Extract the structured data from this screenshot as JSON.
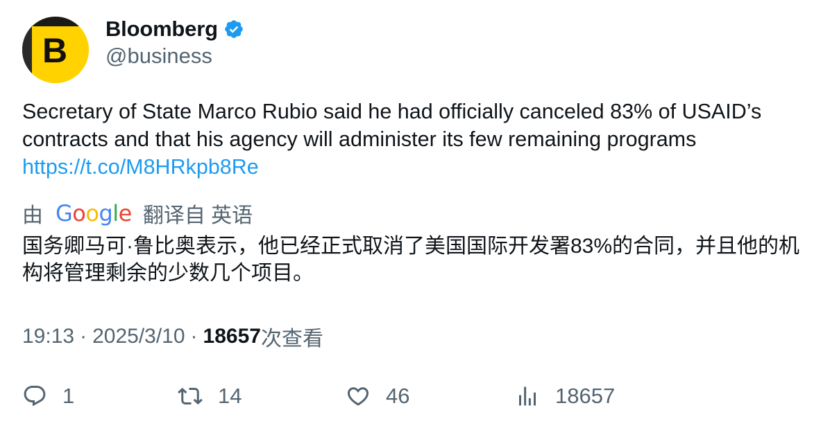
{
  "author": {
    "display_name": "Bloomberg",
    "handle": "@business",
    "avatar_letter": "B",
    "verified": true,
    "avatar_color": "#ffd200"
  },
  "tweet": {
    "text": "Secretary of State Marco Rubio said he had officially canceled 83% of USAID’s contracts and that his agency will administer its few remaining programs",
    "link": "https://t.co/M8HRkpb8Re"
  },
  "translation": {
    "prefix": "由",
    "provider": "Google",
    "suffix": "翻译自 英语",
    "text": "国务卿马可·鲁比奥表示，他已经正式取消了美国国际开发署83%的合同，并且他的机构将管理剩余的少数几个项目。"
  },
  "meta": {
    "time": "19:13",
    "separator": "·",
    "date": "2025/3/10",
    "views_count": "18657",
    "views_label": "次查看"
  },
  "actions": {
    "replies": "1",
    "retweets": "14",
    "likes": "46",
    "views": "18657"
  },
  "colors": {
    "link": "#1d9bf0",
    "secondary_text": "#536471",
    "verified_badge": "#1d9bf0",
    "google_blue": "#4285f4",
    "google_red": "#ea4335",
    "google_yellow": "#fbbc05",
    "google_green": "#34a853"
  },
  "icons": [
    "verified-badge-icon",
    "reply-icon",
    "retweet-icon",
    "like-icon",
    "views-icon",
    "google-logo"
  ]
}
